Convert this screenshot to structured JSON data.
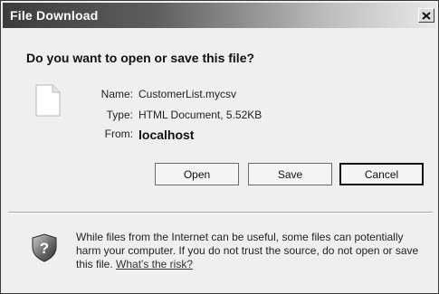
{
  "window": {
    "title": "File Download",
    "close_symbol": "✕",
    "close_icon": "close-icon"
  },
  "prompt": {
    "question": "Do you want to open or save this file?"
  },
  "file": {
    "icon": "document-icon",
    "name_label": "Name:",
    "name_value": "CustomerList.mycsv",
    "type_label": "Type:",
    "type_value": "HTML Document, 5.52KB",
    "from_label": "From:",
    "from_value": "localhost"
  },
  "buttons": {
    "open_label": "Open",
    "save_label": "Save",
    "cancel_label": "Cancel",
    "default_button": "cancel"
  },
  "warning": {
    "icon": "shield-question-icon",
    "text": "While files from the Internet can be useful, some files can potentially harm your computer. If you do not trust the source, do not open or save this file.",
    "link_text": "What's the risk?"
  },
  "colors": {
    "dialog_background": "#efefef",
    "titlebar_dark": "#3c3c3c",
    "titlebar_light": "#e8e8e8",
    "shield_dark": "#2e2e2e",
    "shield_light": "#bdbdbd"
  }
}
